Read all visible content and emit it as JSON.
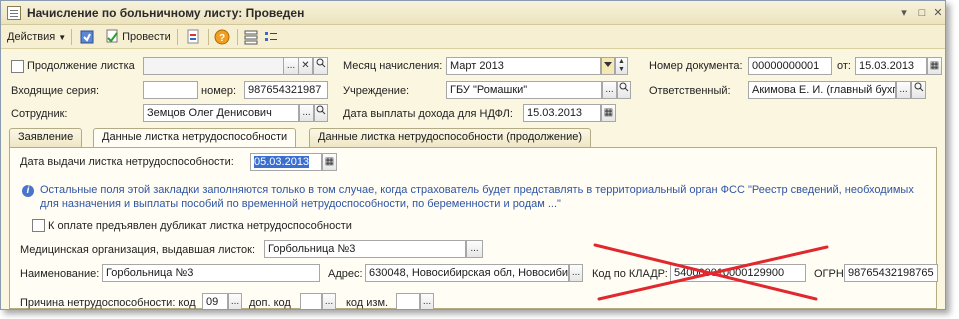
{
  "window": {
    "title": "Начисление по больничному листу: Проведен"
  },
  "toolbar": {
    "actions_label": "Действия",
    "post_label": "Провести"
  },
  "header": {
    "continuation_label": "Продолжение листка",
    "incoming_series_label": "Входящие серия:",
    "number_label": "номер:",
    "number_value": "987654321987",
    "employee_label": "Сотрудник:",
    "employee_value": "Земцов Олег Денисович",
    "month_label": "Месяц начисления:",
    "month_value": "Март 2013",
    "institution_label": "Учреждение:",
    "institution_value": "ГБУ \"Ромашки\"",
    "ndfl_date_label": "Дата выплаты дохода для НДФЛ:",
    "ndfl_date_value": "15.03.2013",
    "doc_number_label": "Номер документа:",
    "doc_number_value": "00000000001",
    "from_label": "от:",
    "from_value": "15.03.2013",
    "responsible_label": "Ответственный:",
    "responsible_value": "Акимова Е. И. (главный бухг"
  },
  "tabs": [
    {
      "label": "Заявление"
    },
    {
      "label": "Данные листка нетрудоспособности"
    },
    {
      "label": "Данные листка нетрудоспособности (продолжение)"
    }
  ],
  "panel": {
    "issue_date_label": "Дата выдачи листка нетрудоспособности:",
    "issue_date_value": "05.03.2013",
    "info_line1": "Остальные поля этой закладки заполняются только в том случае, когда страхователь будет представлять в территориальный орган ФСС \"Реестр сведений, необходимых",
    "info_line2": "для назначения и выплаты пособий по временной нетрудоспособности, по беременности и родам ...\"",
    "duplicate_label": "К оплате предъявлен дубликат листка нетрудоспособности",
    "med_org_label": "Медицинская организация, выдавшая листок:",
    "med_org_value": "Горбольница №3",
    "name_label": "Наименование:",
    "name_value": "Горбольница №3",
    "address_label": "Адрес:",
    "address_value": "630048, Новосибирская обл, Новосиби",
    "kladr_label": "Код по КЛАДР:",
    "kladr_value": "540000010000129900",
    "ogrn_label": "ОГРН:",
    "ogrn_value": "98765432198765",
    "reason_label": "Причина нетрудоспособности: код",
    "reason_code_value": "09",
    "extra_code_label": "доп. код",
    "change_code_label": "код изм."
  },
  "colors": {
    "cross": "#e0282e",
    "accent_blue": "#2f55a4",
    "selection": "#3a6fd0"
  }
}
